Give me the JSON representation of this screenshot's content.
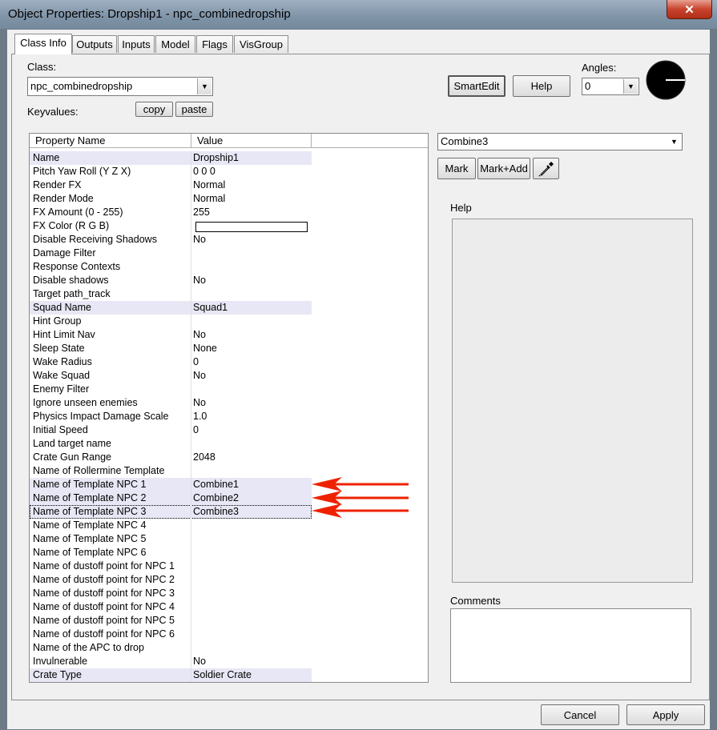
{
  "window": {
    "title": "Object Properties: Dropship1 - npc_combinedropship",
    "close_glyph": "✕"
  },
  "tabs": [
    {
      "label": "Class Info",
      "active": true
    },
    {
      "label": "Outputs"
    },
    {
      "label": "Inputs"
    },
    {
      "label": "Model"
    },
    {
      "label": "Flags"
    },
    {
      "label": "VisGroup"
    }
  ],
  "classinfo": {
    "class_label": "Class:",
    "class_value": "npc_combinedropship",
    "keyvalues_label": "Keyvalues:",
    "copy_label": "copy",
    "paste_label": "paste",
    "smartedit_label": "SmartEdit",
    "help_label": "Help",
    "angles_label": "Angles:",
    "angles_value": "0",
    "arrow_glyph": "▼"
  },
  "table": {
    "col_name": "Property Name",
    "col_value": "Value",
    "rows": [
      {
        "name": "Name",
        "value": "Dropship1",
        "hl": true
      },
      {
        "name": "Pitch Yaw Roll (Y Z X)",
        "value": "0 0 0"
      },
      {
        "name": "Render FX",
        "value": "Normal"
      },
      {
        "name": "Render Mode",
        "value": "Normal"
      },
      {
        "name": "FX Amount (0 - 255)",
        "value": "255"
      },
      {
        "name": "FX Color (R G B)",
        "value": "",
        "swatch": true
      },
      {
        "name": "Disable Receiving Shadows",
        "value": "No"
      },
      {
        "name": "Damage Filter",
        "value": ""
      },
      {
        "name": "Response Contexts",
        "value": ""
      },
      {
        "name": "Disable shadows",
        "value": "No"
      },
      {
        "name": "Target path_track",
        "value": ""
      },
      {
        "name": "Squad Name",
        "value": "Squad1",
        "hl": true
      },
      {
        "name": "Hint Group",
        "value": ""
      },
      {
        "name": "Hint Limit Nav",
        "value": "No"
      },
      {
        "name": "Sleep State",
        "value": "None"
      },
      {
        "name": "Wake Radius",
        "value": "0"
      },
      {
        "name": "Wake Squad",
        "value": "No"
      },
      {
        "name": "Enemy Filter",
        "value": ""
      },
      {
        "name": "Ignore unseen enemies",
        "value": "No"
      },
      {
        "name": "Physics Impact Damage Scale",
        "value": "1.0"
      },
      {
        "name": "Initial Speed",
        "value": "0"
      },
      {
        "name": "Land target name",
        "value": ""
      },
      {
        "name": "Crate Gun Range",
        "value": "2048"
      },
      {
        "name": "Name of Rollermine Template",
        "value": ""
      },
      {
        "name": "Name of Template NPC 1",
        "value": "Combine1",
        "hl": true
      },
      {
        "name": "Name of Template NPC 2",
        "value": "Combine2",
        "hl": true
      },
      {
        "name": "Name of Template NPC 3",
        "value": "Combine3",
        "hl": true,
        "sel": true
      },
      {
        "name": "Name of Template NPC 4",
        "value": ""
      },
      {
        "name": "Name of Template NPC 5",
        "value": ""
      },
      {
        "name": "Name of Template NPC 6",
        "value": ""
      },
      {
        "name": "Name of dustoff point for NPC 1",
        "value": ""
      },
      {
        "name": "Name of dustoff point for NPC 2",
        "value": ""
      },
      {
        "name": "Name of dustoff point for NPC 3",
        "value": ""
      },
      {
        "name": "Name of dustoff point for NPC 4",
        "value": ""
      },
      {
        "name": "Name of dustoff point for NPC 5",
        "value": ""
      },
      {
        "name": "Name of dustoff point for NPC 6",
        "value": ""
      },
      {
        "name": "Name of the APC to drop",
        "value": ""
      },
      {
        "name": "Invulnerable",
        "value": "No"
      },
      {
        "name": "Crate Type",
        "value": "Soldier Crate",
        "hl": true
      }
    ]
  },
  "editor": {
    "value_combo": "Combine3",
    "mark_label": "Mark",
    "markadd_label": "Mark+Add",
    "eyedropper_icon": "eyedropper-icon",
    "help_label": "Help",
    "comments_label": "Comments"
  },
  "footer": {
    "cancel_label": "Cancel",
    "apply_label": "Apply"
  },
  "colors": {
    "annotation_arrow": "#ee2200",
    "highlight_row": "#e7e7f5"
  }
}
